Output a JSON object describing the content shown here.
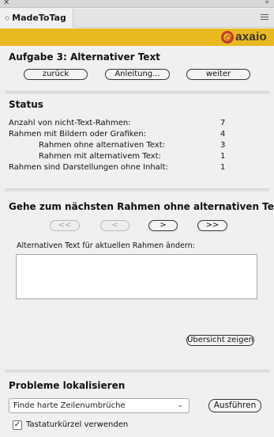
{
  "panel": {
    "close_glyph": "✕",
    "collapse_glyph": "»",
    "tab_dropdown_glyph": "◇",
    "tab_title": "MadeToTag",
    "brand_logo_text": "axaio"
  },
  "task": {
    "title": "Aufgabe 3: Alternativer Text",
    "back_label": "zurück",
    "guide_label": "Anleitung...",
    "next_label": "weiter"
  },
  "status": {
    "title": "Status",
    "rows": [
      {
        "label": "Anzahl von nicht-Text-Rahmen:",
        "value": "7"
      },
      {
        "label": "Rahmen mit Bildern oder Grafiken:",
        "value": "4"
      },
      {
        "label": "Rahmen ohne alternativen Text:",
        "value": "3"
      },
      {
        "label": "Rahmen mit alternativem Text:",
        "value": "1"
      },
      {
        "label": "Rahmen sind Darstellungen ohne Inhalt:",
        "value": "1"
      }
    ]
  },
  "navigate": {
    "title": "Gehe zum nächsten Rahmen ohne alternativen Text",
    "first_label": "<<",
    "prev_label": "<",
    "next_label": ">",
    "last_label": ">>",
    "field_label": "Alternativen Text für aktuellen Rahmen ändern:",
    "field_value": "",
    "overview_label": "Übersicht zeigen"
  },
  "localize": {
    "title": "Probleme lokalisieren",
    "selected_option": "Finde harte Zeilenumbrüche",
    "run_label": "Ausführen",
    "shortcut_checkbox_label": "Tastaturkürzel verwenden",
    "shortcut_checked": true,
    "check_glyph": "✓"
  },
  "colors": {
    "brand_bar": "#e8b921",
    "logo_red": "#c0392b"
  }
}
